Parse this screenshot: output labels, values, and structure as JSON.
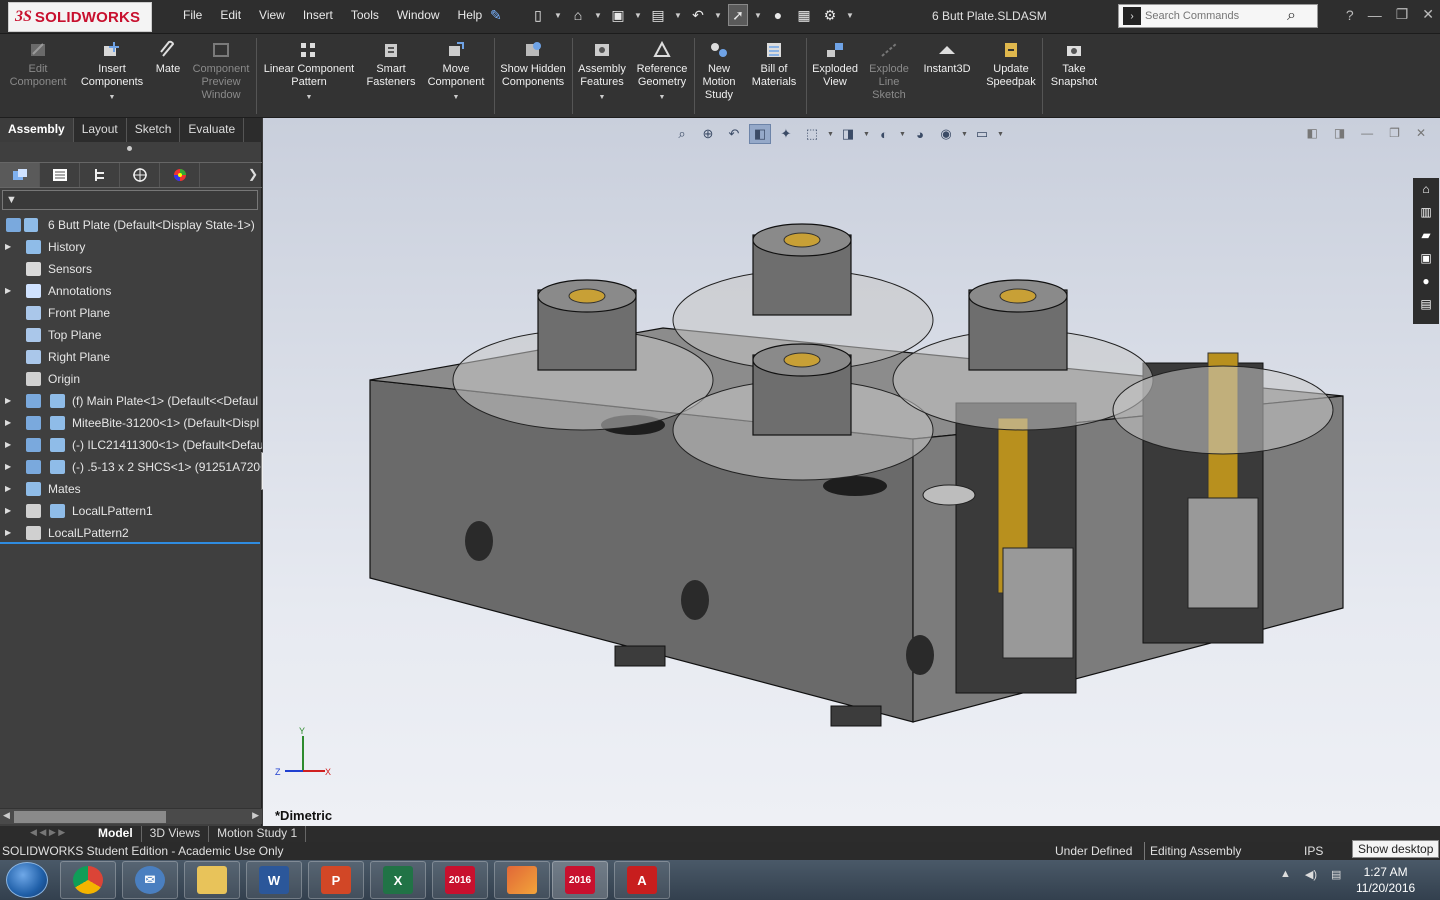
{
  "app": {
    "brand": "SOLIDWORKS",
    "brand_ds": "3S",
    "document_title": "6 Butt Plate.SLDASM",
    "menu": [
      "File",
      "Edit",
      "View",
      "Insert",
      "Tools",
      "Window",
      "Help"
    ],
    "search_placeholder": "Search Commands",
    "accent": "#c8102e"
  },
  "commands": [
    {
      "label": "Edit Component",
      "enabled": false
    },
    {
      "label": "Insert Components",
      "enabled": true
    },
    {
      "label": "Mate",
      "enabled": true
    },
    {
      "label": "Component Preview Window",
      "enabled": false
    },
    {
      "label": "Linear Component Pattern",
      "enabled": true
    },
    {
      "label": "Smart Fasteners",
      "enabled": true
    },
    {
      "label": "Move Component",
      "enabled": true
    },
    {
      "label": "Show Hidden Components",
      "enabled": true
    },
    {
      "label": "Assembly Features",
      "enabled": true
    },
    {
      "label": "Reference Geometry",
      "enabled": true
    },
    {
      "label": "New Motion Study",
      "enabled": true
    },
    {
      "label": "Bill of Materials",
      "enabled": true
    },
    {
      "label": "Exploded View",
      "enabled": true
    },
    {
      "label": "Explode Line Sketch",
      "enabled": false
    },
    {
      "label": "Instant3D",
      "enabled": true
    },
    {
      "label": "Update Speedpak",
      "enabled": true
    },
    {
      "label": "Take Snapshot",
      "enabled": true
    }
  ],
  "tabs": [
    "Assembly",
    "Layout",
    "Sketch",
    "Evaluate"
  ],
  "tree": {
    "root": "6 Butt Plate  (Default<Display State-1>)",
    "items": [
      {
        "label": "History",
        "expandable": true
      },
      {
        "label": "Sensors",
        "expandable": false
      },
      {
        "label": "Annotations",
        "expandable": true
      },
      {
        "label": "Front Plane",
        "expandable": false
      },
      {
        "label": "Top Plane",
        "expandable": false
      },
      {
        "label": "Right Plane",
        "expandable": false
      },
      {
        "label": "Origin",
        "expandable": false
      },
      {
        "label": "(f) Main Plate<1> (Default<<Defaul",
        "expandable": true
      },
      {
        "label": "MiteeBite-31200<1> (Default<Displ",
        "expandable": true
      },
      {
        "label": "(-) ILC21411300<1> (Default<Defau",
        "expandable": true
      },
      {
        "label": "(-) .5-13 x 2 SHCS<1> (91251A720<<",
        "expandable": true
      },
      {
        "label": "Mates",
        "expandable": true
      },
      {
        "label": "LocalLPattern1",
        "expandable": true
      },
      {
        "label": "LocalLPattern2",
        "expandable": true
      }
    ]
  },
  "viewport": {
    "view_name": "*Dimetric",
    "triad": {
      "x": "X",
      "y": "Y",
      "z": "Z"
    }
  },
  "bottom_tabs": [
    "Model",
    "3D Views",
    "Motion Study 1"
  ],
  "status": {
    "left": "SOLIDWORKS Student Edition - Academic Use Only",
    "state": "Under Defined",
    "mode": "Editing Assembly",
    "units": "IPS",
    "show_desktop": "Show desktop"
  },
  "taskbar": {
    "apps": [
      "Chrome",
      "Thunderbird",
      "File Explorer",
      "Word",
      "PowerPoint",
      "Excel",
      "SOLIDWORKS 2016",
      "MATLAB",
      "SOLIDWORKS 2016",
      "Acrobat"
    ],
    "sw_badge": "2016",
    "time": "1:27 AM",
    "date": "11/20/2016"
  }
}
